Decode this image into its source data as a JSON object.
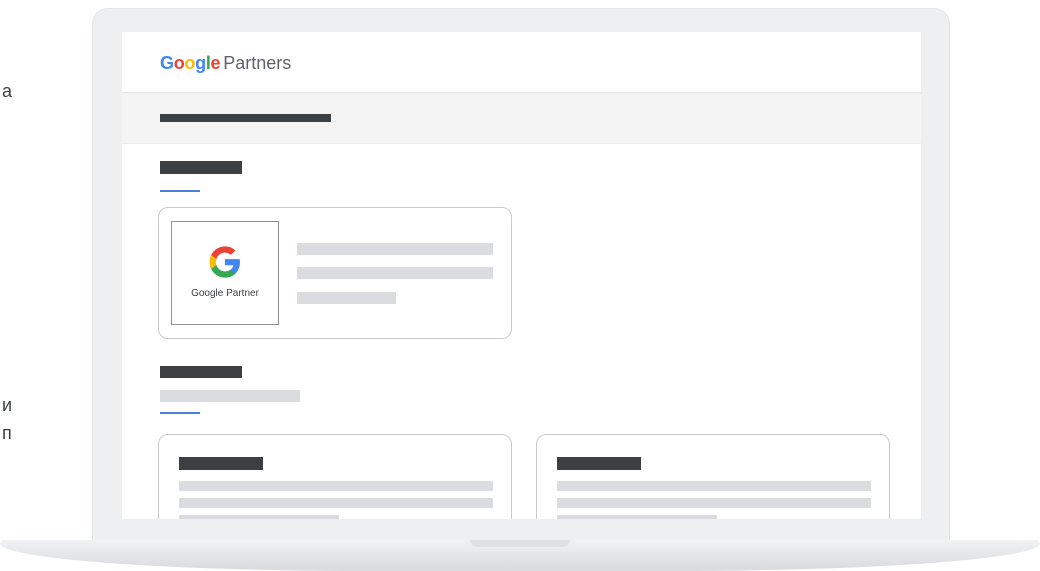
{
  "background_text": {
    "line1": "a",
    "line2": "и",
    "line3": "п"
  },
  "header": {
    "logo": {
      "letters": [
        "G",
        "o",
        "o",
        "g",
        "l",
        "e"
      ],
      "product": "Partners"
    }
  },
  "badge": {
    "icon": "google-g-icon",
    "label": "Google Partner"
  },
  "colors": {
    "accent": "#4a7fdc",
    "google_blue": "#4285f4",
    "google_red": "#ea4335",
    "google_yellow": "#fbbc05",
    "google_green": "#34a853",
    "placeholder_dark": "#3c4043",
    "placeholder_light": "#dadce0"
  }
}
